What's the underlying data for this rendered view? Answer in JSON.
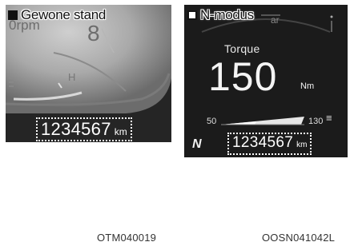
{
  "left_panel": {
    "mode_label": "Gewone stand",
    "dim_rpm": "0rpm",
    "dim_digit": "8",
    "dim_h": "H",
    "odometer": "1234567",
    "odometer_unit": "km"
  },
  "right_panel": {
    "mode_label": "N-modus",
    "torque_label": "Torque",
    "torque_value": "150",
    "torque_unit": "Nm",
    "temp_min": "50",
    "temp_max": "130",
    "odometer": "1234567",
    "odometer_unit": "km",
    "logo": "N"
  },
  "codes": {
    "left": "OTM040019",
    "right": "OOSN041042L"
  },
  "colors": {
    "left_bg": "#252525",
    "right_bg": "#1b1b1b",
    "text_light": "#ffffff"
  }
}
